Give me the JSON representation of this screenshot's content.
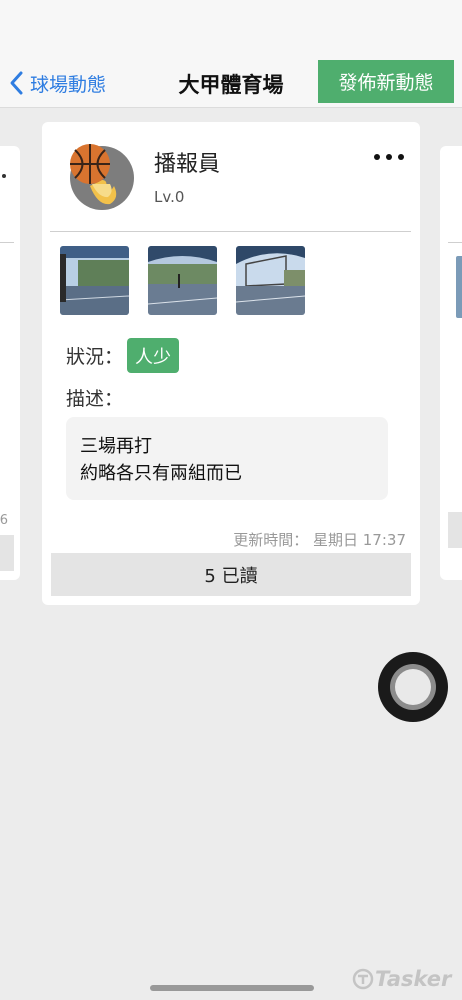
{
  "nav": {
    "back_label": "球場動態",
    "title": "大甲體育場",
    "publish_label": "發佈新動態"
  },
  "post": {
    "username": "播報員",
    "level": "Lv.0",
    "status_label": "狀況：",
    "status_value": "人少",
    "description_label": "描述：",
    "description_lines": [
      "三場再打",
      "約略各只有兩組而已"
    ],
    "update_label": "更新時間：",
    "update_time": "星期日 17:37",
    "read_count": "5 已讀"
  },
  "side_left": {
    "partial_number": "6"
  },
  "icons": {
    "back": "chevron-left-icon",
    "more": "more-horizontal-icon",
    "avatar": "basketball-icon",
    "assistive": "assistive-touch-icon"
  },
  "colors": {
    "accent_green": "#4fae6e",
    "link_blue": "#2f7de1"
  },
  "watermark": "Tasker"
}
